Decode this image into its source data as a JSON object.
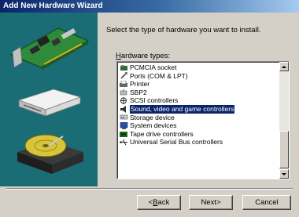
{
  "window": {
    "title": "Add New Hardware Wizard"
  },
  "instruction": "Select the type of hardware you want to install.",
  "list": {
    "label_prefix": "",
    "label_accel": "H",
    "label_rest": "ardware types:",
    "items": [
      {
        "label": "PCMCIA socket",
        "icon": "pcmcia-socket-icon"
      },
      {
        "label": "Ports (COM & LPT)",
        "icon": "port-connector-icon"
      },
      {
        "label": "Printer",
        "icon": "printer-icon"
      },
      {
        "label": "SBP2",
        "icon": "sbp2-device-icon"
      },
      {
        "label": "SCSI controllers",
        "icon": "scsi-controller-icon"
      },
      {
        "label": "Sound, video and game controllers",
        "icon": "sound-speaker-icon"
      },
      {
        "label": "Storage device",
        "icon": "storage-device-icon"
      },
      {
        "label": "System devices",
        "icon": "system-device-icon"
      },
      {
        "label": "Tape drive controllers",
        "icon": "tape-drive-icon"
      },
      {
        "label": "Universal Serial Bus controllers",
        "icon": "usb-icon"
      }
    ],
    "selected_index": 5
  },
  "buttons": {
    "back_prefix": "< ",
    "back_accel": "B",
    "back_rest": "ack",
    "next_prefix": "Next",
    "next_suffix": " >",
    "cancel": "Cancel"
  },
  "colors": {
    "title_bar": "#0a246a",
    "side_panel": "#1a6d74",
    "selection": "#0a246a",
    "dialog_face": "#d4d0c8"
  }
}
